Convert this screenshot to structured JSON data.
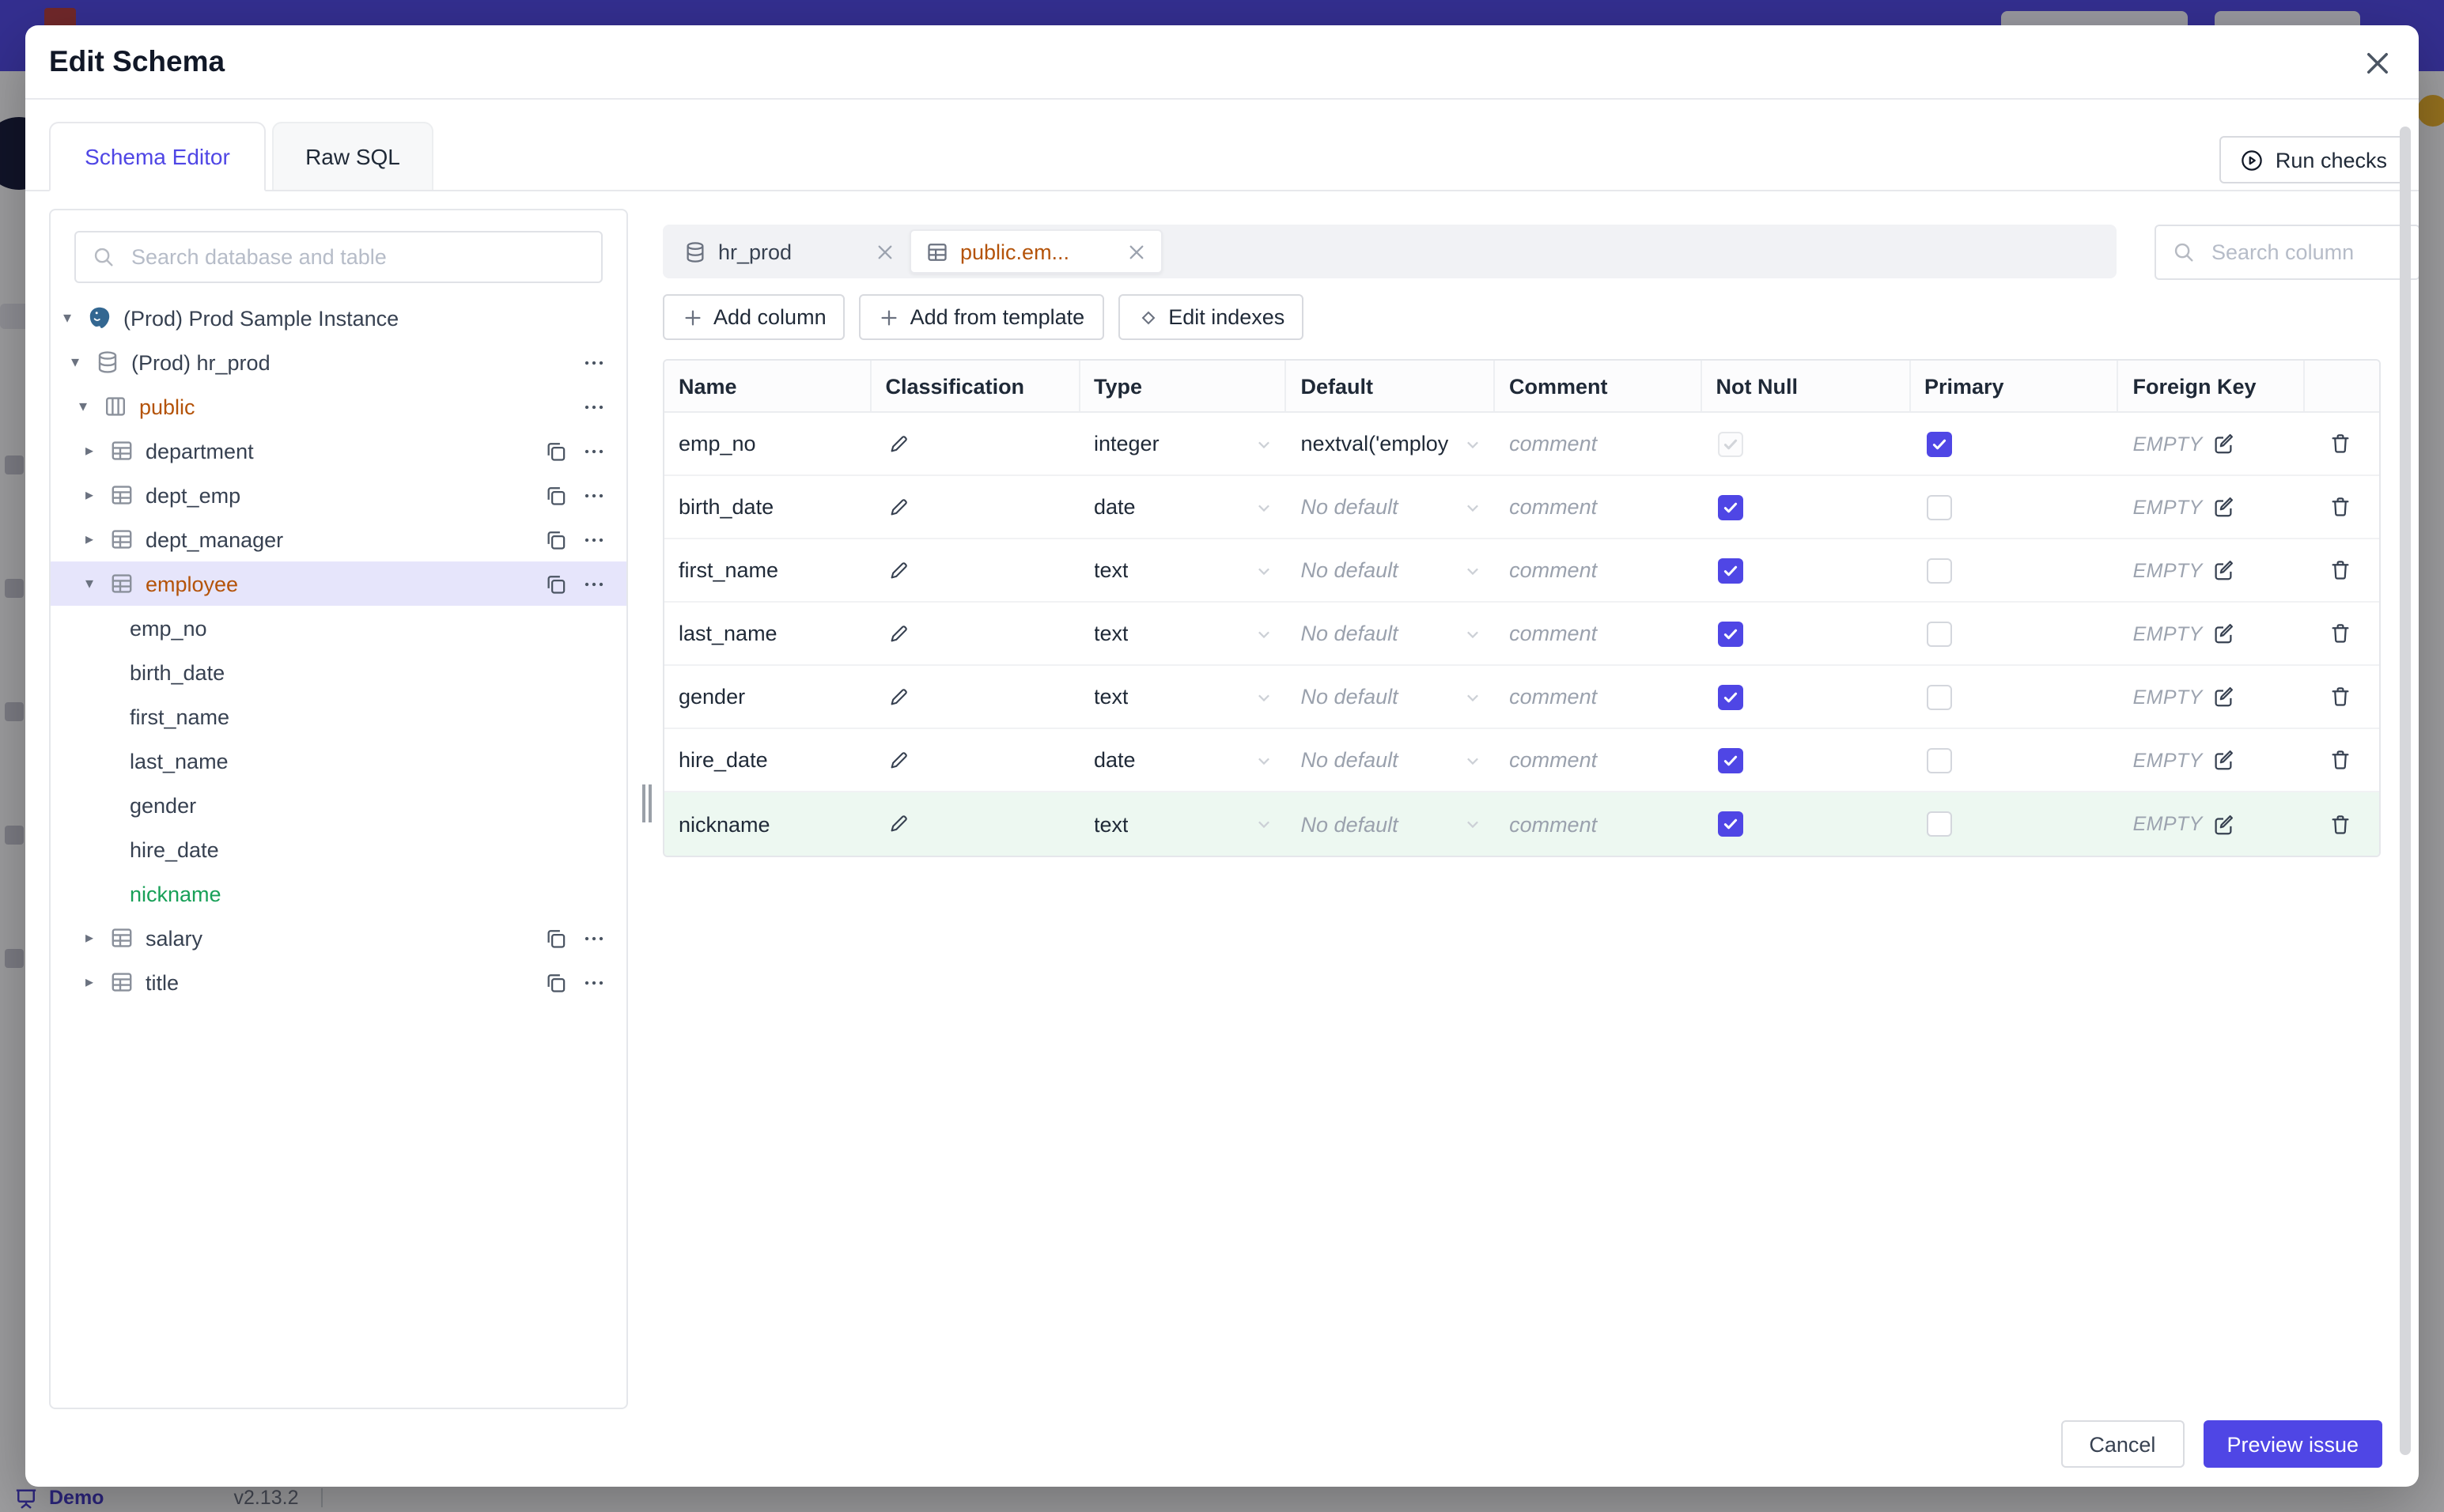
{
  "colors": {
    "accent": "#4f46e5",
    "topbar": "#4f46e5",
    "amber_modified": "#b45309",
    "green_new": "#18a058",
    "selected_tree_bg": "#e6e5fb",
    "new_row_bg": "#edf8f1"
  },
  "background_page": {
    "status_bar": {
      "demo_label": "Demo",
      "version": "v2.13.2"
    }
  },
  "modal": {
    "title": "Edit Schema",
    "run_checks_label": "Run checks",
    "tabs": [
      {
        "label": "Schema Editor",
        "active": true
      },
      {
        "label": "Raw SQL",
        "active": false
      }
    ],
    "sidebar": {
      "search_placeholder": "Search database and table",
      "tree": [
        {
          "label": "(Prod) Prod Sample Instance",
          "level": 0,
          "chevron": "down",
          "icon": "postgres",
          "color": "default",
          "actions": []
        },
        {
          "label": "(Prod) hr_prod",
          "level": 1,
          "chevron": "down",
          "icon": "database",
          "color": "default",
          "actions": [
            "more"
          ]
        },
        {
          "label": "public",
          "level": 2,
          "chevron": "down",
          "icon": "schema",
          "color": "amber",
          "actions": [
            "more"
          ]
        },
        {
          "label": "department",
          "level": 3,
          "chevron": "right",
          "icon": "table",
          "color": "default",
          "actions": [
            "copy",
            "more"
          ]
        },
        {
          "label": "dept_emp",
          "level": 3,
          "chevron": "right",
          "icon": "table",
          "color": "default",
          "actions": [
            "copy",
            "more"
          ]
        },
        {
          "label": "dept_manager",
          "level": 3,
          "chevron": "right",
          "icon": "table",
          "color": "default",
          "actions": [
            "copy",
            "more"
          ]
        },
        {
          "label": "employee",
          "level": 3,
          "chevron": "down",
          "icon": "table",
          "color": "amber",
          "selected": true,
          "actions": [
            "copy",
            "more"
          ]
        },
        {
          "label": "emp_no",
          "level": 4,
          "chevron": null,
          "icon": null,
          "color": "default",
          "actions": []
        },
        {
          "label": "birth_date",
          "level": 4,
          "chevron": null,
          "icon": null,
          "color": "default",
          "actions": []
        },
        {
          "label": "first_name",
          "level": 4,
          "chevron": null,
          "icon": null,
          "color": "default",
          "actions": []
        },
        {
          "label": "last_name",
          "level": 4,
          "chevron": null,
          "icon": null,
          "color": "default",
          "actions": []
        },
        {
          "label": "gender",
          "level": 4,
          "chevron": null,
          "icon": null,
          "color": "default",
          "actions": []
        },
        {
          "label": "hire_date",
          "level": 4,
          "chevron": null,
          "icon": null,
          "color": "default",
          "actions": []
        },
        {
          "label": "nickname",
          "level": 4,
          "chevron": null,
          "icon": null,
          "color": "green",
          "actions": []
        },
        {
          "label": "salary",
          "level": 3,
          "chevron": "right",
          "icon": "table",
          "color": "default",
          "actions": [
            "copy",
            "more"
          ]
        },
        {
          "label": "title",
          "level": 3,
          "chevron": "right",
          "icon": "table",
          "color": "default",
          "actions": [
            "copy",
            "more"
          ]
        }
      ]
    },
    "editor": {
      "tabs": [
        {
          "label": "hr_prod",
          "icon": "database",
          "active": false
        },
        {
          "label": "public.em...",
          "icon": "table",
          "active": true
        }
      ],
      "search_placeholder": "Search column",
      "toolbar": [
        {
          "label": "Add column",
          "icon": "plus"
        },
        {
          "label": "Add from template",
          "icon": "plus"
        },
        {
          "label": "Edit indexes",
          "icon": "diamond"
        }
      ],
      "grid": {
        "headers": [
          "Name",
          "Classification",
          "Type",
          "Default",
          "Comment",
          "Not Null",
          "Primary",
          "Foreign Key",
          ""
        ],
        "comment_placeholder": "comment",
        "no_default_placeholder": "No default",
        "foreign_key_empty": "EMPTY",
        "rows": [
          {
            "name": "emp_no",
            "type": "integer",
            "default_value": "nextval('employ",
            "has_default": true,
            "not_null": "disabled-checked",
            "primary": true,
            "highlight": null
          },
          {
            "name": "birth_date",
            "type": "date",
            "default_value": "",
            "has_default": false,
            "not_null": "checked",
            "primary": false,
            "highlight": null
          },
          {
            "name": "first_name",
            "type": "text",
            "default_value": "",
            "has_default": false,
            "not_null": "checked",
            "primary": false,
            "highlight": null
          },
          {
            "name": "last_name",
            "type": "text",
            "default_value": "",
            "has_default": false,
            "not_null": "checked",
            "primary": false,
            "highlight": null
          },
          {
            "name": "gender",
            "type": "text",
            "default_value": "",
            "has_default": false,
            "not_null": "checked",
            "primary": false,
            "highlight": null
          },
          {
            "name": "hire_date",
            "type": "date",
            "default_value": "",
            "has_default": false,
            "not_null": "checked",
            "primary": false,
            "highlight": null
          },
          {
            "name": "nickname",
            "type": "text",
            "default_value": "",
            "has_default": false,
            "not_null": "checked",
            "primary": false,
            "highlight": "green"
          }
        ]
      }
    },
    "footer": {
      "cancel_label": "Cancel",
      "submit_label": "Preview issue"
    }
  }
}
